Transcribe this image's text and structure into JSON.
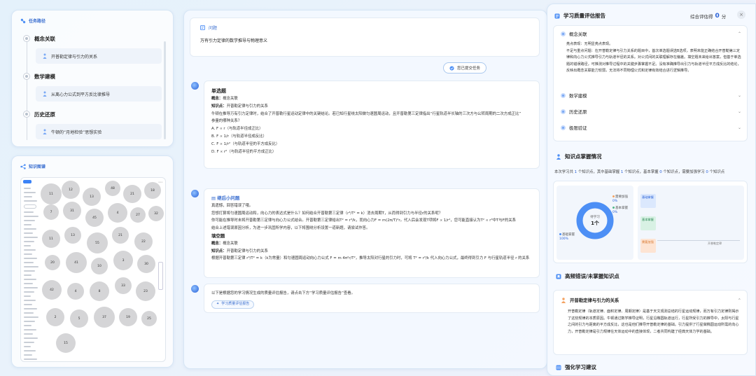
{
  "task_path": {
    "title": "任务路径",
    "items": [
      {
        "title": "概念关联",
        "sub": "开普勒定律与引力的关系"
      },
      {
        "title": "数学建模",
        "sub": "从离心力公式到平方反比律推导"
      },
      {
        "title": "历史还原",
        "sub": "牛顿的“月地检验”思想实验"
      }
    ]
  },
  "graph": {
    "title": "知识图谱",
    "bubbles": [
      "11",
      "12",
      "13",
      "48",
      "21",
      "18",
      "7",
      "31",
      "45",
      "4",
      "27",
      "32",
      "11",
      "13",
      "55",
      "21",
      "22",
      "20",
      "41",
      "10",
      "3",
      "30",
      "42",
      "4",
      "8",
      "33",
      "23",
      "2",
      "5",
      "37",
      "19",
      "25",
      "15"
    ]
  },
  "chat": {
    "question_label": "问题",
    "question_text": "万有引力定律的数学推导与物理意义",
    "submitted_label": "您已提交任务",
    "msg1": {
      "heading": "单选题",
      "concept_label": "概念：",
      "concept": "概念关联",
      "kp_label": "知识点：",
      "kp": "开普勒定律与引力的关系",
      "stem": "牛顿在推导万有引力定律时，结合了开普勒行星运动定律中的关键结论。若已知行星绕太阳做匀速圆周运动，且开普勒第三定律指出“行星轨道半长轴的三次方与公转周期的二次方成正比”",
      "stem2": "参量的哪种关系？",
      "options": [
        "A. F ∝ r（与轨道半径成正比）",
        "B. F ∝ 1/r（与轨道半径成反比）",
        "C. F ∝ 1/r²（与轨道半径的平方成反比）",
        "D. F ∝ r²（与轨道半径的平方成正比）"
      ]
    },
    "msg2": {
      "link": "继后小问题",
      "l1": "真遗憾，回答错误了哦。",
      "l2": "您想打算将匀速圆周运动和，向心力的表达式是什么？如何结合开普勒第三定律（r³/T² = k）消去周期T，从而得到引力与半径r的关系呢？",
      "l3": "你可能在推导时未将开普勒第三定律与向心力公式结合。开普勒第三定律给出T² = r³/k，而向心力F = m(2π/T)²r。代入后会发现T项将F ∝ 1/r²，您可能直接认为T² ∝ r³中T与F的关系",
      "l4": "结合上述错误原因分析，为进一步巩固所学内容，以下将围绕分析设置一道新题，请尝试作答。",
      "heading": "填空题",
      "concept_label": "概念：",
      "concept": "概念关联",
      "kp_label": "知识点：",
      "kp": "开普勒定律与引力的关系",
      "l5": "根据开普勒第三定律 r³/T² = k（k为常量）和匀速圆周运动向心力公式 F = m 4π²r/T²，推导太阳对行星的引力时，可将 T² = r³/k 代入向心力公式，最终得到引力 F 与行星轨道半径 r 的关系"
    },
    "msg3": {
      "text": "以下是根据您的学习情况生成的质量评估报告，请点击下方“学习质量评估报告”查看。",
      "chip": "学习质量评估报告"
    }
  },
  "report": {
    "title": "学习质量评估报告",
    "score_label": "综合评估得",
    "score": "0",
    "score_unit": "分",
    "close": "×",
    "eval": {
      "sections": [
        "概念关联",
        "数学建模",
        "历史还原",
        "极限验证"
      ],
      "body1": "亮点表现：无明显亮点表现。",
      "body2": "不足与重点问题：在开普勒定律与引力关系的题目中，首次单选题误选B选项，表明未能正确结合开普勒第三定律和向心力公式推导引力与轨道半径的关系。对公式间的关联理解存在偏差。填空题未来给出答案，但基于单选题的错误路径，可推测对推导过程中的关键步骤掌握不足。没有准确推导出引力与轨道半径平方成反比的结论，反映出概念关联能力较弱，无法将不同物理公式和定律有效结合进行逻辑推导。"
    },
    "kp": {
      "title": "知识点掌握情况",
      "summary_parts": [
        "本次学习共 ",
        "1",
        " 个知识点，其中基础掌握 ",
        "1",
        " 个知识点，基本掌握 ",
        "0",
        " 个知识点，需要加强学习 ",
        "0",
        " 个知识点"
      ],
      "donut_label": "待学习",
      "donut_value": "1个",
      "legend": [
        {
          "name": "需要加强",
          "value": "0%",
          "color": "#f4a261"
        },
        {
          "name": "基本掌握",
          "value": "0%",
          "color": "#52b788"
        },
        {
          "name": "基础掌握",
          "value": "100%",
          "color": "#4d8ff5"
        }
      ],
      "boxes": [
        {
          "name": "基础掌握",
          "color": "#dbe8fd",
          "text": "#2a62d8"
        },
        {
          "name": "基本掌握",
          "color": "#d8f1e4",
          "text": "#2d8a57"
        },
        {
          "name": "需要加强",
          "color": "#fde4d3",
          "text": "#d7742a"
        }
      ],
      "line_label": "开普勒定律",
      "chart_data": {
        "type": "pie",
        "categories": [
          "需要加强",
          "基本掌握",
          "基础掌握"
        ],
        "values": [
          0,
          0,
          100
        ]
      }
    },
    "hf": {
      "title": "高频错误/未掌握知识点",
      "item": "开普勒定律与引力的关系",
      "body": "开普勒定律（轨道定律、面积定律、周期定律）是基于天文观测总结的行星运动规律，而万有引力定律则揭示了这些规律的本质原因。牛顿通过数学推导证明，行星沿椭圆轨道运行，行星所受引力的推导中，太阳与行星之间的引力与距离的平方成反比，这也是他们推导开普勒定律的基础。引力提供了行星做椭圆运动所需的向心力，开普勒定律是引力规律在天体运动中的直接体现，二者共同构建了经典天体力学的基础。"
    },
    "strengthen": "强化学习建议"
  }
}
